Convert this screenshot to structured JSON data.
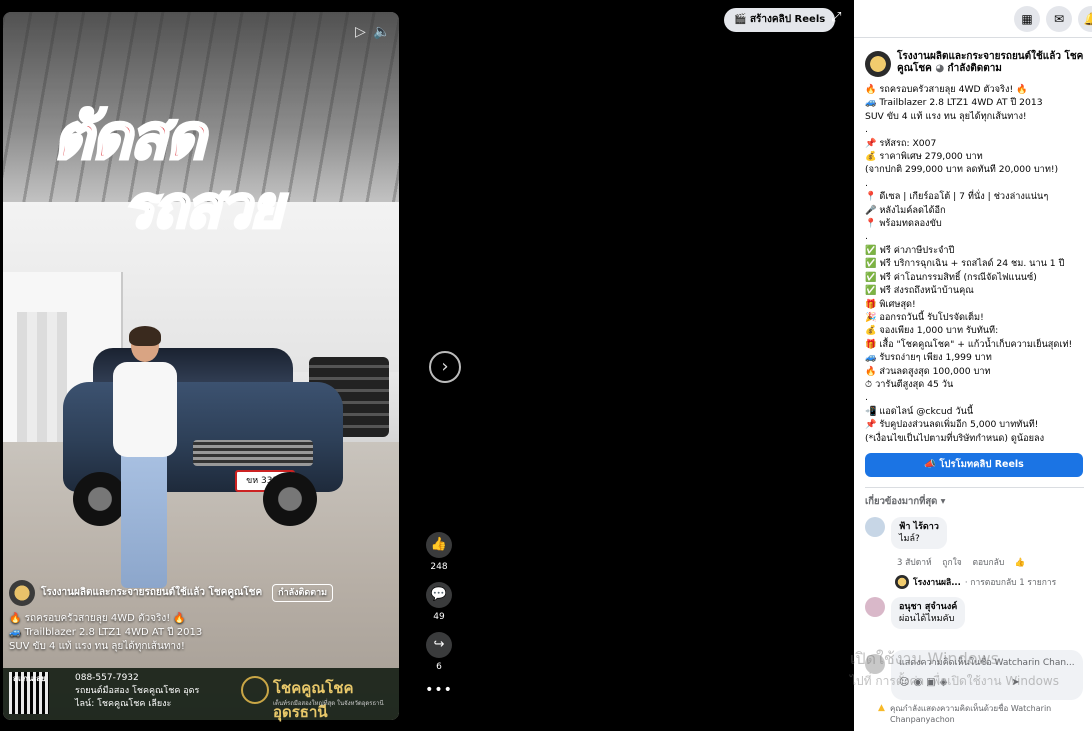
{
  "video": {
    "promo_line1": "ตัดสด",
    "promo_line2": "รถสวย",
    "plate": "ขห 3310",
    "owner": "โรงงานผลิตและกระจายรถยนต์ใช้แล้ว โชคคูณโชค",
    "follow": "กำลังติดตาม",
    "caption_line1": "🔥 รถครอบครัวสายลุย 4WD ตัวจริง! 🔥",
    "caption_line2": "🚙 Trailblazer 2.8 LTZ1 4WD AT ปี 2013",
    "caption_line3": "SUV ขับ 4 แท้ แรง ทน ลุยได้ทุกเส้นทาง!",
    "banner_phone": "088-557-7932",
    "banner_fb": "รถยนต์มือสอง โชคคูณโชค อุดร",
    "banner_line": "ไลน์: โชคคูณโชค เลียงะ",
    "banner_scan": "สแกนเลย",
    "banner_logo": "โชคคูณโชค อุดรธานี",
    "banner_logo_sub": "เต็นท์รถมือสองใหญ่ที่สุด ในจังหวัดอุดรธานี"
  },
  "rail": {
    "likes": "248",
    "comments": "49",
    "shares": "6",
    "more": "•••"
  },
  "header": {
    "create_reel": "สร้างคลิป Reels"
  },
  "panel": {
    "page_name": "โรงงานผลิตและกระจายรถยนต์ใช้แล้ว โชคคูณโชค",
    "following": "กำลังติดตาม",
    "post_text": "🔥 รถครอบครัวสายลุย 4WD ตัวจริง! 🔥\n🚙 Trailblazer 2.8 LTZ1 4WD AT ปี 2013\nSUV ขับ 4 แท้ แรง ทน ลุยได้ทุกเส้นทาง!\n.\n📌 รหัสรถ: X007\n💰 ราคาพิเศษ 279,000 บาท\n(จากปกติ 299,000 บาท ลดทันที 20,000 บาท!)\n.\n📍 ดีเซล | เกียร์ออโต้ | 7 ที่นั่ง | ช่วงล่างแน่นๆ\n🎤 หลังไมค์ลดได้อีก\n📍 พร้อมทดลองขับ\n.\n✅ ฟรี ค่าภาษีประจำปี\n✅ ฟรี บริการฉุกเฉิน + รถสไลด์ 24 ชม. นาน 1 ปี\n✅ ฟรี ค่าโอนกรรมสิทธิ์ (กรณีจัดไฟแนนซ์)\n✅ ฟรี ส่งรถถึงหน้าบ้านคุณ\n🎁 พิเศษสุด!\n🎉 ออกรถวันนี้ รับโปรจัดเต็ม!\n💰 จองเพียง 1,000 บาท รับทันที:\n🎁 เสื้อ \"โชคคูณโชค\" + แก้วน้ำเก็บความเย็นสุดเท่!\n🚙 รับรถง่ายๆ เพียง 1,999 บาท\n🔥 ส่วนลดสูงสุด 100,000 บาท\n⏱ วารันตีสูงสุด 45 วัน\n.\n📲 แอดไลน์ @ckcud วันนี้\n📌 รับคูปองส่วนลดเพิ่มอีก 5,000 บาททันที!\n(*เงื่อนไขเป็นไปตามที่บริษัทกำหนด) ดูน้อยลง",
    "boost_button": "โปรโมทคลิป Reels",
    "sort_label": "เกี่ยวข้องมากที่สุด ▾",
    "comments": [
      {
        "name": "ฟ้า ไร้ดาว",
        "text": "ไมล์?",
        "time": "3 สัปดาห์",
        "like": "ถูกใจ",
        "reply": "ตอบกลับ"
      },
      {
        "name": "อนุชา สุจำนงค์",
        "text": "ผ่อนได้ไหมคับ"
      }
    ],
    "reply_summary_name": "โรงงานผลิ...",
    "reply_summary": "· การตอบกลับ 1 รายการ",
    "composer_placeholder": "แสดงความคิดเห็นในชื่อ Watcharin Chan...",
    "notice": "คุณกำลังแสดงความคิดเห็นด้วยชื่อ Watcharin Chanpanyachon"
  },
  "watermark": {
    "line1": "เปิดใช้งาน Windows",
    "line2": "ไปที่ การตั้งค่า เพื่อเปิดใช้งาน Windows"
  }
}
